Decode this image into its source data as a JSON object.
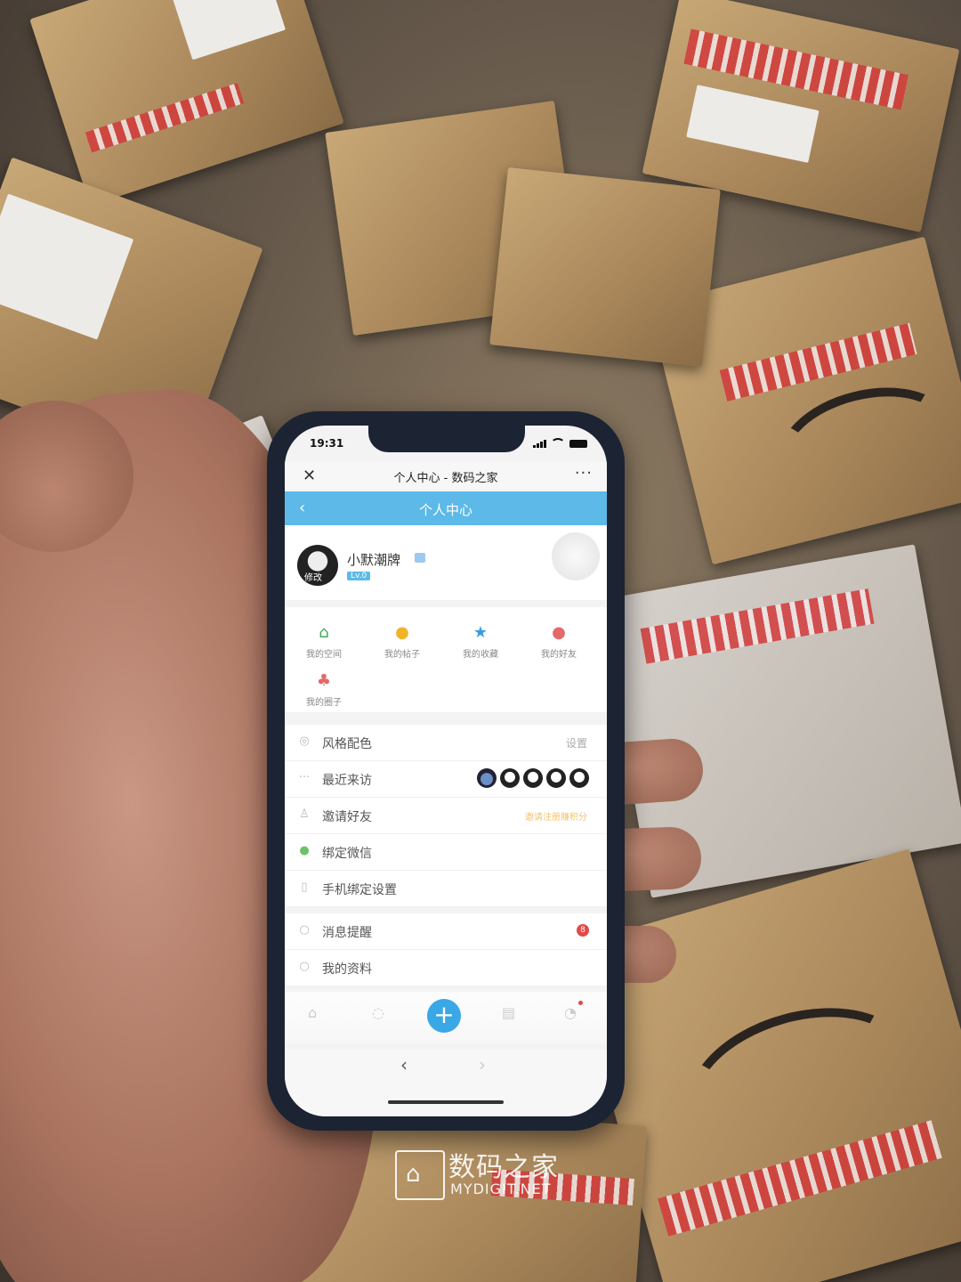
{
  "status": {
    "time": "19:31"
  },
  "wechat": {
    "title": "个人中心 - 数码之家",
    "close": "✕",
    "more": "···"
  },
  "header": {
    "title": "个人中心",
    "back": "‹"
  },
  "profile": {
    "username": "小默潮牌",
    "avatar_edit": "修改",
    "level": "Lv.0"
  },
  "grid": [
    {
      "label": "我的空间",
      "icon": "home-icon",
      "color": "#3eaa55",
      "glyph": "⌂"
    },
    {
      "label": "我的帖子",
      "icon": "chat-icon",
      "color": "#f0b429",
      "glyph": "●"
    },
    {
      "label": "我的收藏",
      "icon": "star-icon",
      "color": "#3a9be0",
      "glyph": "★"
    },
    {
      "label": "我的好友",
      "icon": "friend-icon",
      "color": "#e36a6a",
      "glyph": "●"
    },
    {
      "label": "我的圈子",
      "icon": "group-icon",
      "color": "#e36a6a",
      "glyph": "♣"
    }
  ],
  "list": [
    {
      "label": "风格配色",
      "right": "设置",
      "icon": "palette-icon",
      "glyph": "◎"
    },
    {
      "label": "最近来访",
      "icon": "visitor-icon",
      "glyph": ""
    },
    {
      "label": "邀请好友",
      "right": "邀请注册赚积分",
      "icon": "user-icon",
      "glyph": "♙"
    },
    {
      "label": "绑定微信",
      "icon": "wechat-icon",
      "glyph": "●"
    },
    {
      "label": "手机绑定设置",
      "icon": "phone-icon",
      "glyph": "▯"
    }
  ],
  "list2": [
    {
      "label": "消息提醒",
      "badge": "8",
      "icon": "bell-icon",
      "glyph": "○"
    },
    {
      "label": "我的资料",
      "icon": "profile-icon",
      "glyph": "○"
    }
  ],
  "tabbar": {
    "plus": "+"
  },
  "browser": {
    "back": "‹",
    "forward": "›"
  },
  "watermark": {
    "cn": "数码之家",
    "en": "MYDIGIT.NET"
  }
}
